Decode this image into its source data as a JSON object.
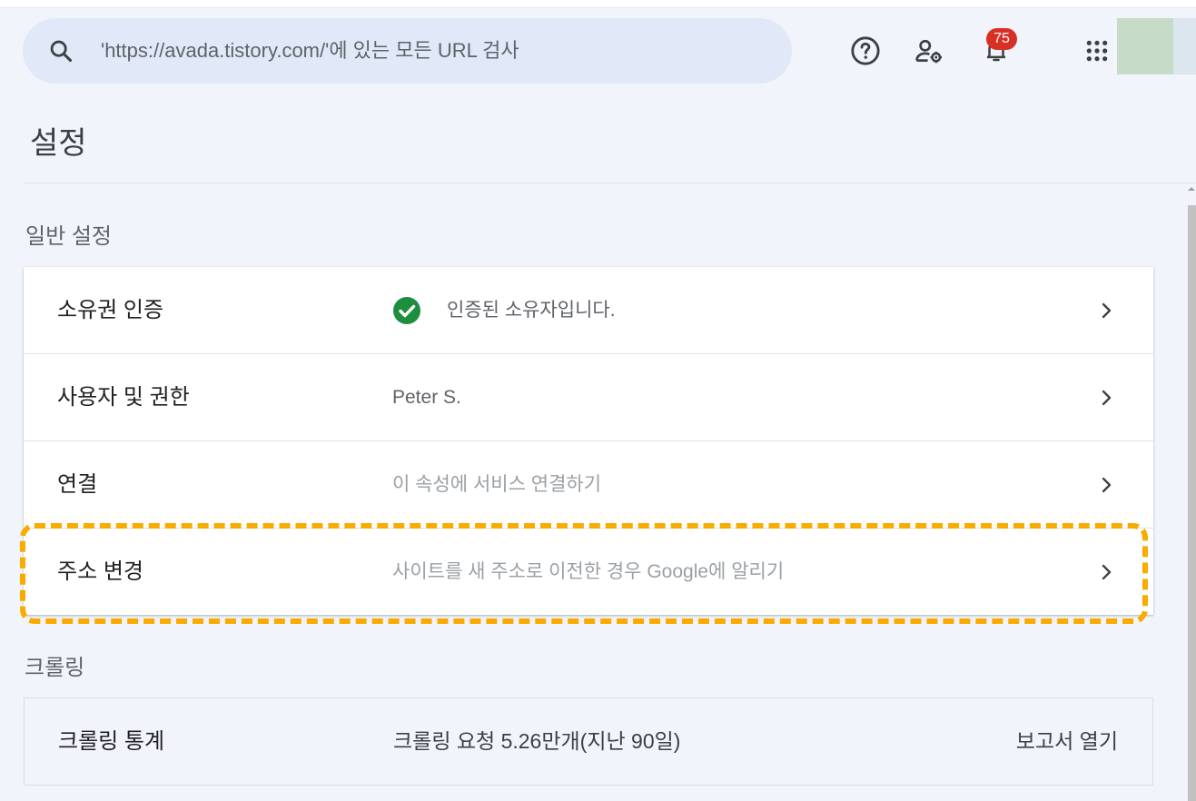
{
  "header": {
    "search_placeholder": "'https://avada.tistory.com/'에 있는 모든 URL 검사",
    "notification_count": "75",
    "icons": [
      "search-icon",
      "help-icon",
      "admin-settings-icon",
      "bell-icon",
      "apps-grid-icon"
    ]
  },
  "page": {
    "title": "설정"
  },
  "general": {
    "label": "일반 설정",
    "rows": [
      {
        "title": "소유권 인증",
        "value": "인증된 소유자입니다.",
        "status_icon": "check-circle-icon",
        "status_color": "#1e8e3e"
      },
      {
        "title": "사용자 및 권한",
        "value": "Peter S."
      },
      {
        "title": "연결",
        "value": "이 속성에 서비스 연결하기"
      },
      {
        "title": "주소 변경",
        "value": "사이트를 새 주소로 이전한 경우 Google에 알리기"
      }
    ]
  },
  "crawling": {
    "label": "크롤링",
    "row": {
      "title": "크롤링 통계",
      "value": "크롤링 요청 5.26만개(지난 90일)",
      "link": "보고서 열기"
    }
  },
  "colors": {
    "highlight": "#f9ab00",
    "badge": "#d93025",
    "background": "#f1f4fb"
  }
}
